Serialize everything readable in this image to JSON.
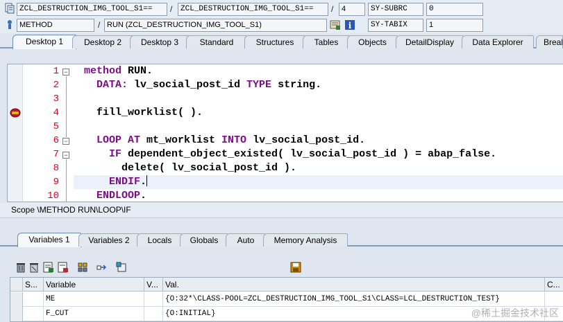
{
  "info_bar": {
    "program_field": "ZCL_DESTRUCTION_IMG_TOOL_S1==",
    "include_field": "ZCL_DESTRUCTION_IMG_TOOL_S1==",
    "line_number": "4",
    "sy_subrc_label": "SY-SUBRC",
    "sy_subrc_value": "0",
    "event_type": "METHOD",
    "event_name": "RUN (ZCL_DESTRUCTION_IMG_TOOL_S1)",
    "sy_tabix_label": "SY-TABIX",
    "sy_tabix_value": "1",
    "slash": "/"
  },
  "desktop_tabs": [
    "Desktop 1",
    "Desktop 2",
    "Desktop 3",
    "Standard",
    "Structures",
    "Tables",
    "Objects",
    "DetailDisplay",
    "Data Explorer",
    "Break"
  ],
  "code": {
    "lines": [
      {
        "no": "1",
        "parts": [
          {
            "t": "method",
            "k": true
          },
          {
            "t": " RUN.",
            "k": false
          }
        ]
      },
      {
        "no": "2",
        "parts": [
          {
            "t": "  DATA:",
            "k": true
          },
          {
            "t": " lv_social_post_id ",
            "k": false
          },
          {
            "t": "TYPE",
            "k": true
          },
          {
            "t": " string.",
            "k": false
          }
        ]
      },
      {
        "no": "3",
        "parts": []
      },
      {
        "no": "4",
        "parts": [
          {
            "t": "  fill_worklist( ).",
            "k": false
          }
        ]
      },
      {
        "no": "5",
        "parts": []
      },
      {
        "no": "6",
        "parts": [
          {
            "t": "  LOOP AT",
            "k": true
          },
          {
            "t": " mt_worklist ",
            "k": false
          },
          {
            "t": "INTO",
            "k": true
          },
          {
            "t": " lv_social_post_id.",
            "k": false
          }
        ]
      },
      {
        "no": "7",
        "parts": [
          {
            "t": "    IF",
            "k": true
          },
          {
            "t": " dependent_object_existed( lv_social_post_id ) = abap_false.",
            "k": false
          }
        ]
      },
      {
        "no": "8",
        "parts": [
          {
            "t": "      delete( lv_social_post_id ).",
            "k": false
          }
        ]
      },
      {
        "no": "9",
        "parts": [
          {
            "t": "    ENDIF",
            "k": true
          },
          {
            "t": ".",
            "k": false
          }
        ]
      },
      {
        "no": "10",
        "parts": [
          {
            "t": "  ENDLOOP",
            "k": true
          },
          {
            "t": ".",
            "k": false
          }
        ]
      }
    ]
  },
  "scope": "Scope \\METHOD RUN\\LOOP\\IF",
  "variable_tabs": [
    "Variables 1",
    "Variables 2",
    "Locals",
    "Globals",
    "Auto",
    "Memory Analysis"
  ],
  "toolbar_icons": [
    "delete-icon",
    "delete-all-icon",
    "save-variables-icon",
    "load-variables-icon",
    "hierarchy-icon",
    "navigate-icon",
    "new-object-icon",
    "save-layout-icon"
  ],
  "variables_table": {
    "headers": [
      "S...",
      "Variable",
      "V...",
      "Val.",
      "C..."
    ],
    "rows": [
      {
        "name": "ME",
        "value": "{O:32*\\CLASS-POOL=ZCL_DESTRUCTION_IMG_TOOL_S1\\CLASS=LCL_DESTRUCTION_TEST}"
      },
      {
        "name": "F_CUT",
        "value": "{O:INITIAL}"
      }
    ]
  },
  "watermark": "@稀土掘金技术社区",
  "colors": {
    "keyword": "#7d0b8a",
    "line_number": "#e3001b",
    "background": "#dfe6ef"
  }
}
